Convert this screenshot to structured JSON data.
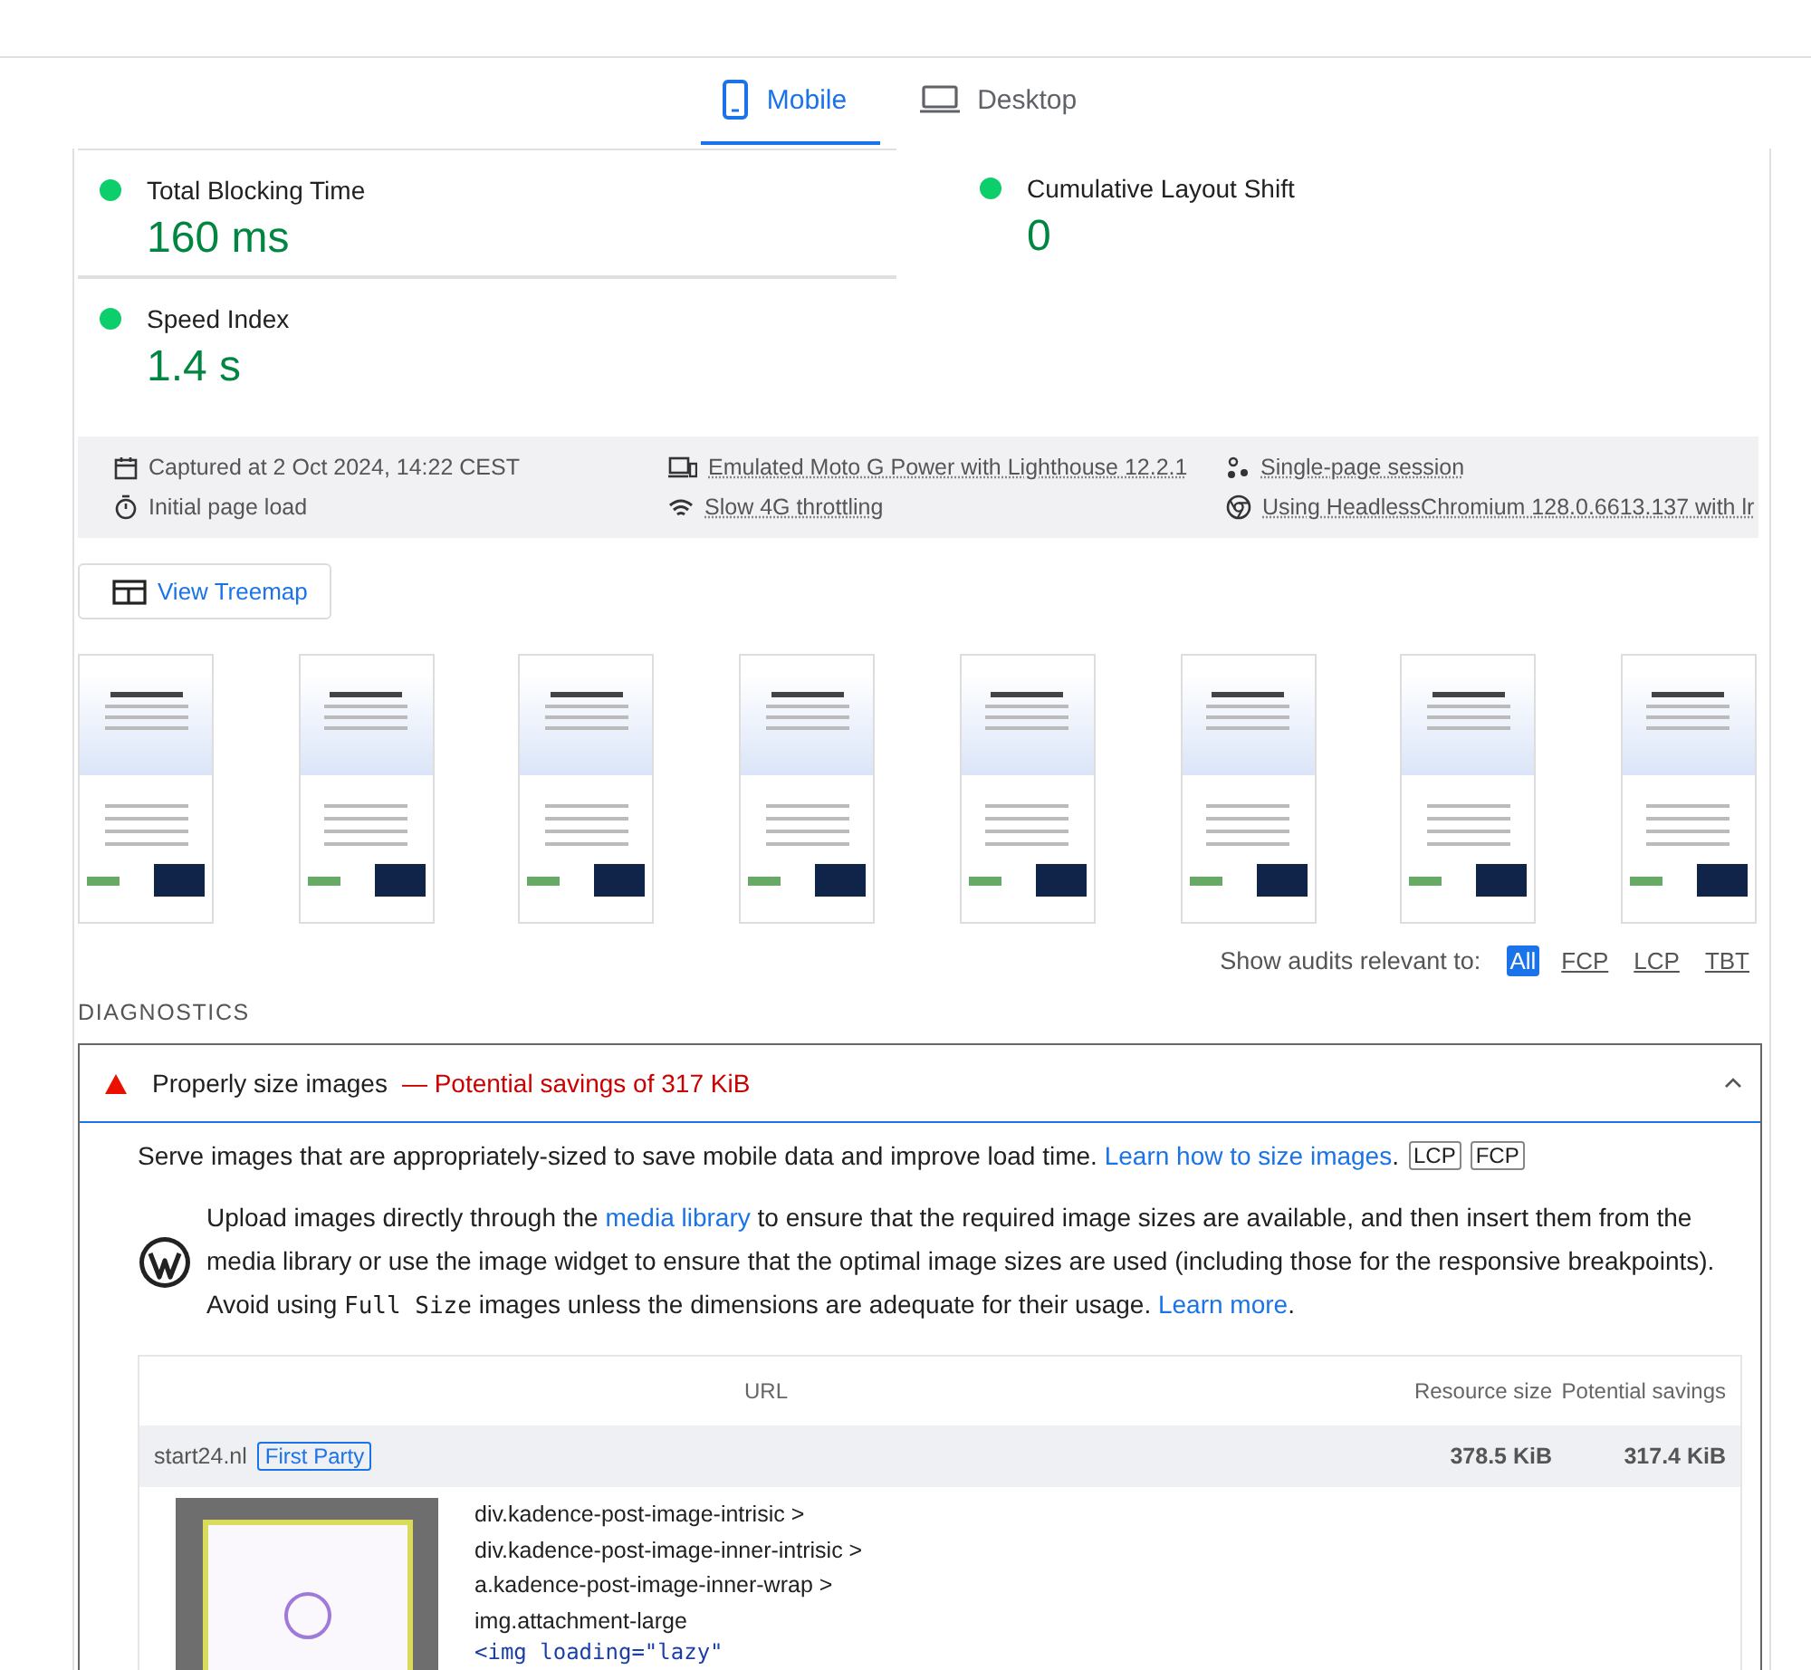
{
  "tabs": [
    {
      "label": "Mobile",
      "kind": "phone",
      "selected": true
    },
    {
      "label": "Desktop",
      "kind": "monitor",
      "selected": false
    }
  ],
  "metrics": [
    {
      "name": "Total Blocking Time",
      "value": "160 ms",
      "color": "#0cce6b"
    },
    {
      "name": "Cumulative Layout Shift",
      "value": "0",
      "color": "#0cce6b"
    },
    {
      "name": "Speed Index",
      "value": "1.4 s",
      "color": "#0cce6b"
    }
  ],
  "environment": [
    {
      "kind": "calendar",
      "text": "Captured at 2 Oct 2024, 14:22 CEST",
      "underlined": false
    },
    {
      "kind": "device",
      "text": "Emulated Moto G Power with Lighthouse 12.2.1",
      "underlined": true
    },
    {
      "kind": "session",
      "text": "Single-page session",
      "underlined": true
    },
    {
      "kind": "timer",
      "text": "Initial page load",
      "underlined": false
    },
    {
      "kind": "signal",
      "text": "Slow 4G throttling",
      "underlined": true
    },
    {
      "kind": "browser",
      "text": "Using HeadlessChromium 128.0.6613.137 with lr",
      "underlined": true
    }
  ],
  "treemap_button": "View Treemap",
  "audit_filter": {
    "label": "Show audits relevant to:",
    "options": [
      {
        "label": "All",
        "selected": true
      },
      {
        "label": "FCP",
        "selected": false
      },
      {
        "label": "LCP",
        "selected": false
      },
      {
        "label": "TBT",
        "selected": false
      }
    ]
  },
  "section_title": "DIAGNOSTICS",
  "audit": {
    "color": "#eb0f00",
    "title": "Properly size images",
    "separator": "—",
    "savings": "Potential savings of 317 KiB",
    "expanded": true,
    "description": {
      "text": "Serve images that are appropriately-sized to save mobile data and improve load time.",
      "link": "Learn how to size images",
      "tail": ".",
      "tags": [
        "LCP",
        "FCP"
      ]
    },
    "stack_pack": {
      "before": "Upload images directly through the",
      "link": "media library",
      "after": "to ensure that the required image sizes are available, and then insert them from the media library or use the image widget to ensure that the optimal image sizes are used (including those for the responsive breakpoints). Avoid using",
      "code": "Full Size",
      "end": "images unless the dimensions are adequate for their usage.",
      "link2": "Learn more",
      "tail": "."
    },
    "table": {
      "columns": [
        "URL",
        "Resource size",
        "Potential savings"
      ],
      "group": {
        "label": "start24.nl",
        "badge": "First Party",
        "resource_size": "378.5 KiB",
        "savings": "317.4 KiB"
      },
      "item": {
        "selector_lines": [
          "div.kadence-post-image-intrisic >",
          "div.kadence-post-image-inner-intrisic >",
          "a.kadence-post-image-inner-wrap >",
          "img.attachment-large"
        ],
        "snippet": "<img loading=\"lazy\""
      }
    }
  }
}
